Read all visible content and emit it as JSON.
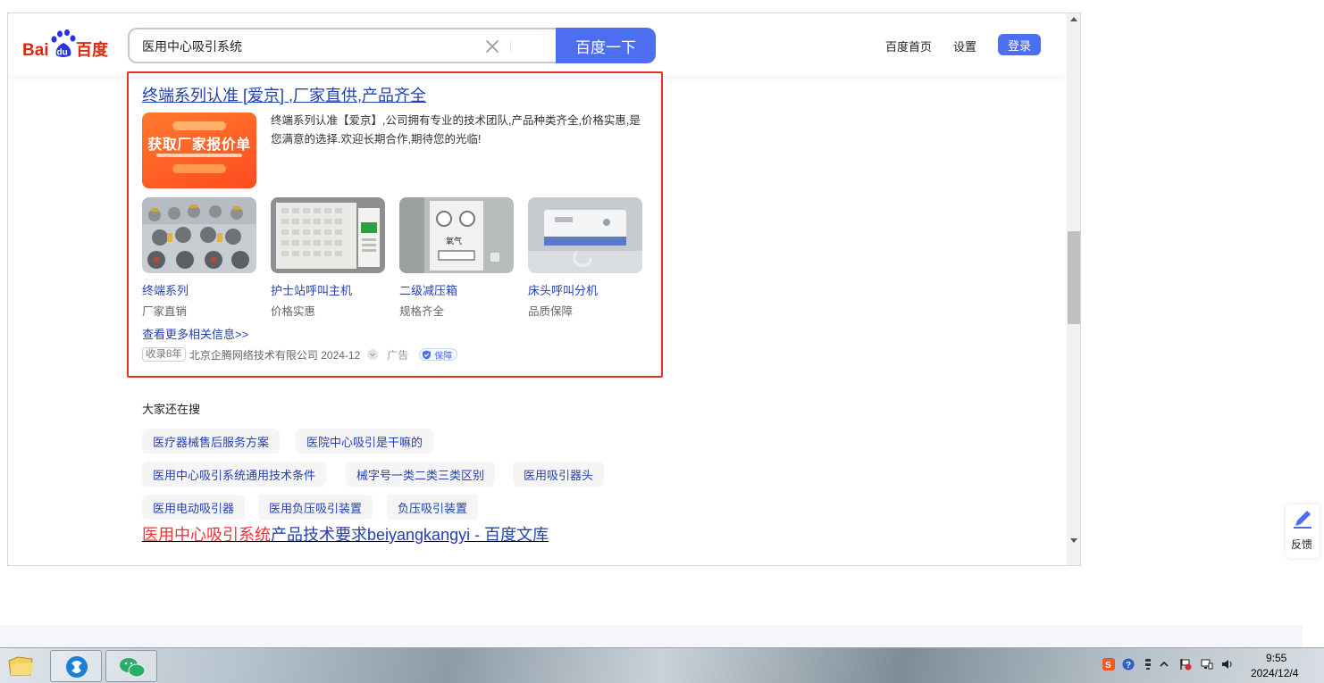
{
  "header": {
    "logo_text_bai": "Bai",
    "logo_text_du": "du",
    "logo_text_cn": "百度",
    "search_value": "医用中心吸引系统",
    "search_button": "百度一下",
    "nav_home": "百度首页",
    "nav_settings": "设置",
    "login": "登录"
  },
  "ad": {
    "title": "终端系列认准 [爱京] ,厂家直供,产品齐全",
    "banner_headline": "获取厂家报价单",
    "description": "终端系列认准【爱京】,公司拥有专业的技术团队,产品种类齐全,价格实惠,是您满意的选择.欢迎长期合作,期待您的光临!",
    "products": [
      {
        "title": "终端系列",
        "subtitle": "厂家直销"
      },
      {
        "title": "护士站呼叫主机",
        "subtitle": "价格实惠"
      },
      {
        "title": "二级减压箱",
        "subtitle": "规格齐全"
      },
      {
        "title": "床头呼叫分机",
        "subtitle": "品质保障"
      }
    ],
    "more_link": "查看更多相关信息>>",
    "indexed_tag": "收录8年",
    "source": "北京企腾网络技术有限公司 2024-12",
    "ad_label": "广告",
    "guarantee": "保障"
  },
  "related": {
    "title": "大家还在搜",
    "chips": [
      "医疗器械售后服务方案",
      "医院中心吸引是干嘛的",
      "医用中心吸引系统通用技术条件",
      "械字号一类二类三类区别",
      "医用吸引器头",
      "医用电动吸引器",
      "医用负压吸引装置",
      "负压吸引装置"
    ]
  },
  "result": {
    "title_highlight": "医用中心吸引系统",
    "title_rest": "产品技术要求beiyangkangyi - 百度文库"
  },
  "feedback": {
    "label": "反馈"
  },
  "taskbar": {
    "time": "9:55",
    "date": "2024/12/4"
  },
  "colors": {
    "brand_blue": "#4e6ef2",
    "link_blue": "#2440b3",
    "highlight_red": "#f73131",
    "ad_frame_red": "#e8322a"
  }
}
